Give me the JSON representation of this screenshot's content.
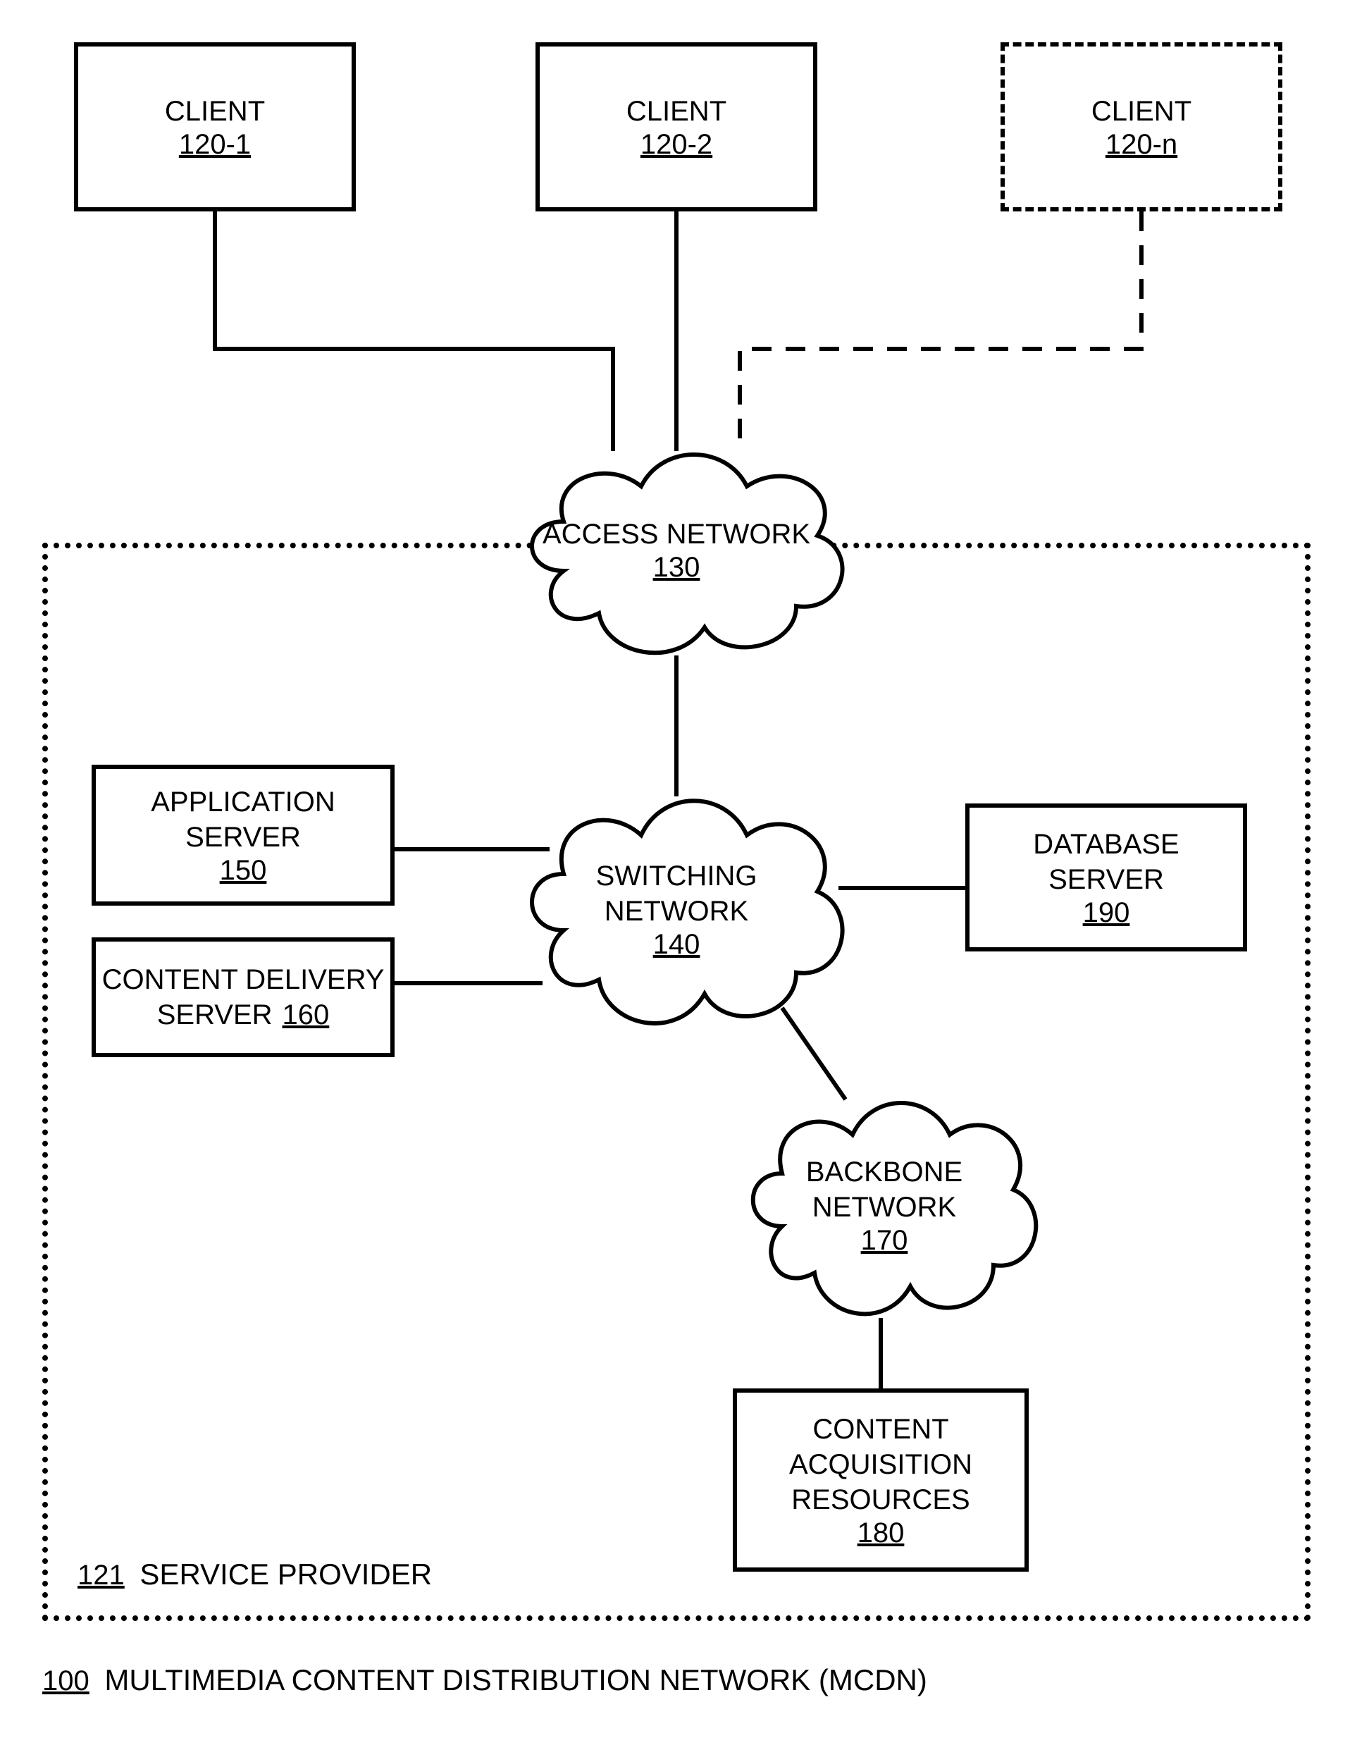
{
  "clients": {
    "c1": {
      "label": "CLIENT",
      "ref": "120-1"
    },
    "c2": {
      "label": "CLIENT",
      "ref": "120-2"
    },
    "cn": {
      "label": "CLIENT",
      "ref": "120-n"
    }
  },
  "service_provider": {
    "ref": "121",
    "label": "SERVICE PROVIDER"
  },
  "nodes": {
    "access_network": {
      "label": "ACCESS NETWORK",
      "ref": "130"
    },
    "switching_network": {
      "label": "SWITCHING NETWORK",
      "ref": "140"
    },
    "backbone_network": {
      "label": "BACKBONE NETWORK",
      "ref": "170"
    },
    "application_server": {
      "label1": "APPLICATION",
      "label2": "SERVER",
      "ref": "150"
    },
    "content_delivery_server": {
      "label1": "CONTENT DELIVERY",
      "label2a": "SERVER",
      "ref": "160"
    },
    "database_server": {
      "label1": "DATABASE",
      "label2": "SERVER",
      "ref": "190"
    },
    "content_acquisition": {
      "label1": "CONTENT",
      "label2": "ACQUISITION",
      "label3": "RESOURCES",
      "ref": "180"
    }
  },
  "footer": {
    "ref": "100",
    "label": "MULTIMEDIA CONTENT DISTRIBUTION NETWORK (MCDN)"
  }
}
